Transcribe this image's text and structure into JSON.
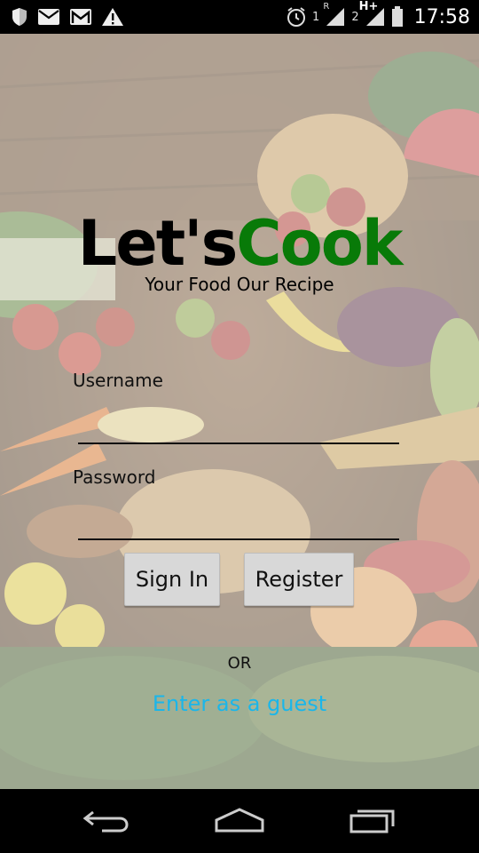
{
  "status_bar": {
    "sim1_label": "1",
    "sim1_roaming": "R",
    "sim2_label": "2",
    "network_type": "H+",
    "time": "17:58",
    "icons": [
      "shield-icon",
      "mail-icon",
      "gmail-icon",
      "warning-icon",
      "alarm-icon",
      "signal-icon",
      "battery-icon"
    ]
  },
  "app": {
    "logo_part1": "Let's",
    "logo_part2": "Cook",
    "tagline": "Your Food Our Recipe",
    "brand_color": "#087a08"
  },
  "login_form": {
    "username_label": "Username",
    "username_value": "",
    "password_label": "Password",
    "password_value": "",
    "sign_in_label": "Sign In",
    "register_label": "Register",
    "or_text": "OR",
    "guest_link": "Enter as a guest",
    "link_color": "#1ab6ea"
  },
  "nav_bar": {
    "icons": [
      "back-icon",
      "home-icon",
      "recents-icon"
    ]
  }
}
